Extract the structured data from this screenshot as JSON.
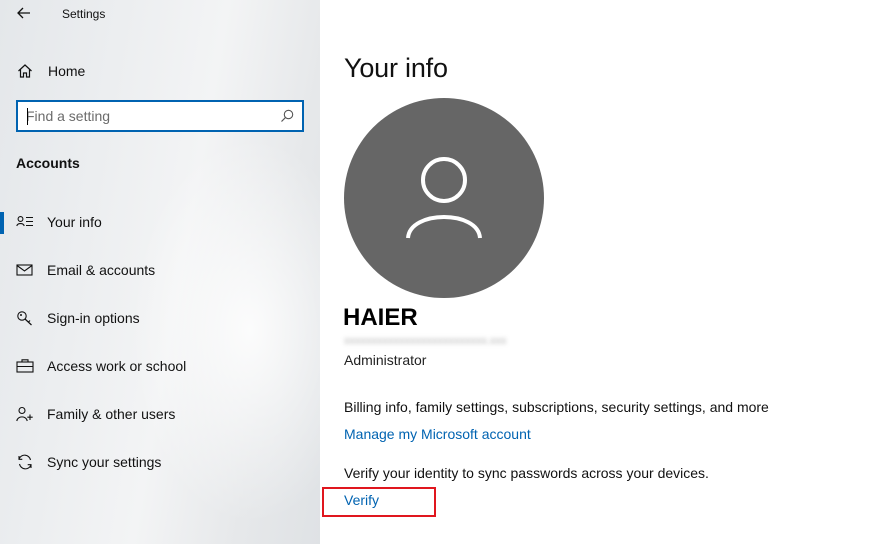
{
  "window": {
    "title": "Settings"
  },
  "sidebar": {
    "home_label": "Home",
    "search_placeholder": "Find a setting",
    "section_heading": "Accounts",
    "items": [
      {
        "label": "Your info",
        "icon": "person-card-icon",
        "selected": true
      },
      {
        "label": "Email & accounts",
        "icon": "mail-icon",
        "selected": false
      },
      {
        "label": "Sign-in options",
        "icon": "key-icon",
        "selected": false
      },
      {
        "label": "Access work or school",
        "icon": "briefcase-icon",
        "selected": false
      },
      {
        "label": "Family & other users",
        "icon": "add-person-icon",
        "selected": false
      },
      {
        "label": "Sync your settings",
        "icon": "sync-icon",
        "selected": false
      }
    ]
  },
  "main": {
    "title": "Your info",
    "user": {
      "name": "HAIER",
      "role": "Administrator"
    },
    "billing_text": "Billing info, family settings, subscriptions, security settings, and more",
    "manage_link": "Manage my Microsoft account",
    "verify_text": "Verify your identity to sync passwords across your devices.",
    "verify_link": "Verify"
  },
  "colors": {
    "accent": "#0063b1",
    "highlight_box": "#e0161e",
    "avatar_bg": "#666666"
  }
}
